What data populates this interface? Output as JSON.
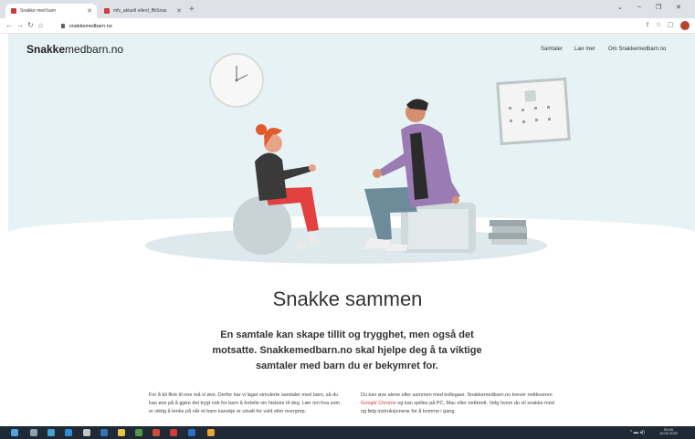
{
  "browser": {
    "tabs": [
      {
        "label": "Snakke med barn",
        "active": true
      },
      {
        "label": "mfs_aktuell ellerd_ffbSnas",
        "active": false
      }
    ],
    "new_tab_symbol": "+",
    "url": "snakkemedbarn.no",
    "window_controls": [
      "⌄",
      "–",
      "❐",
      "✕"
    ],
    "nav_icons": [
      "back-icon",
      "forward-icon",
      "reload-icon",
      "home-icon"
    ]
  },
  "site": {
    "logo_bold": "Snakke",
    "logo_rest": "medbarn.no",
    "nav": [
      "Samtaler",
      "Lær mer",
      "Om Snakkemedbarn.no"
    ]
  },
  "hero": {
    "illustration": "two people talking",
    "colors": {
      "sky": "#e6f2f3",
      "accent_red": "#d0393e",
      "purple": "#9b7bb4"
    }
  },
  "content": {
    "headline": "Snakke sammen",
    "subhead": "En samtale kan skape tillit og trygghet, men også det motsatte. Snakkemedbarn.no skal hjelpe deg å ta viktige samtaler med barn du er bekymret for.",
    "col_left": "For å bli flink til noe må vi øve. Derfor har vi laget simulerte samtaler med barn, så du kan øve på å gjøre det trygt nok for barn å fortelle sin historie til deg. Lær om hva som er viktig å tenke på når et barn kanskje er utsatt for vold eller overgrep.",
    "col_right_a": "Du kan øve alene eller sammen med kollegaer. Snakkemedbarn.no krever nettleseren ",
    "col_right_link": "Google Chrome",
    "col_right_b": " og kan spilles på PC, Mac eller nettbrett. Velg hvem du vil snakke med og følg instruksjonene for å komme i gang."
  },
  "taskbar": {
    "time": "09:49",
    "date": "16.01.2022",
    "icons": [
      "windows-icon",
      "search-icon",
      "chrome-icon",
      "edge-icon",
      "teams-icon",
      "outlook-icon",
      "explorer-icon",
      "pdf-icon",
      "office-icon",
      "word-icon"
    ]
  }
}
